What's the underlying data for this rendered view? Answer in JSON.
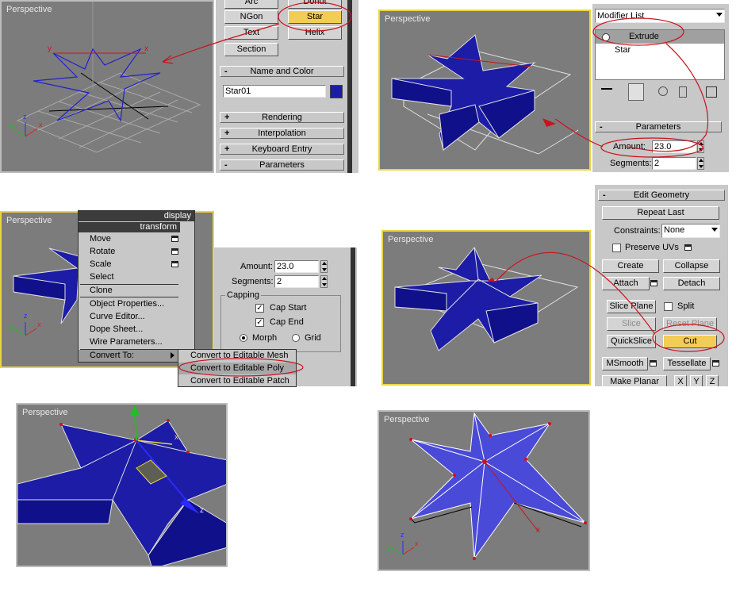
{
  "viewport_label": "Perspective",
  "colors": {
    "highlight": "#f2cc55",
    "annotation": "#c8141e",
    "star_fill": "#1c1ca6",
    "star_fill_light": "#4a4ad8",
    "viewport_bg": "#7c7c7c",
    "panel_bg": "#c8c8c8"
  },
  "panel1": {
    "buttons": {
      "arc": "Arc",
      "donut": "Donut",
      "ngon": "NGon",
      "star": "Star",
      "text": "Text",
      "helix": "Helix",
      "section": "Section"
    },
    "rollouts": {
      "name_color": "Name and Color",
      "rendering": "Rendering",
      "interpolation": "Interpolation",
      "keyboard": "Keyboard Entry",
      "parameters": "Parameters"
    },
    "name_value": "Star01",
    "minus": "-",
    "plus": "+"
  },
  "panel2": {
    "modifier_list": "Modifier List",
    "stack": {
      "extrude": "Extrude",
      "star": "Star"
    },
    "parameters": "Parameters",
    "amount_label": "Amount:",
    "amount_value": "23.0",
    "segments_label": "Segments:",
    "segments_value": "2"
  },
  "panel3": {
    "header_display": "display",
    "header_transform": "transform",
    "menu_items": [
      "Move",
      "Rotate",
      "Scale",
      "Select",
      "Clone",
      "Object Properties...",
      "Curve Editor...",
      "Dope Sheet...",
      "Wire Parameters..."
    ],
    "convert_to": "Convert To:",
    "submenu": [
      "Convert to Editable Mesh",
      "Convert to Editable Poly",
      "Convert to Editable Patch"
    ],
    "amount_label": "Amount:",
    "amount_value": "23.0",
    "segments_label": "Segments:",
    "segments_value": "2",
    "capping": "Capping",
    "cap_start": "Cap Start",
    "cap_end": "Cap End",
    "morph": "Morph",
    "grid": "Grid"
  },
  "panel4": {
    "edit_geometry": "Edit Geometry",
    "repeat_last": "Repeat Last",
    "constraints_label": "Constraints:",
    "constraints_value": "None",
    "preserve_uvs": "Preserve UVs",
    "create": "Create",
    "collapse": "Collapse",
    "attach": "Attach",
    "detach": "Detach",
    "slice_plane": "Slice Plane",
    "split": "Split",
    "slice": "Slice",
    "reset_plane": "Reset Plane",
    "quickslice": "QuickSlice",
    "cut": "Cut",
    "msmooth": "MSmooth",
    "tessellate": "Tessellate",
    "make_planar": "Make Planar",
    "x": "X",
    "y": "Y",
    "z": "Z"
  },
  "axes": {
    "x": "x",
    "y": "y",
    "z": "z"
  }
}
